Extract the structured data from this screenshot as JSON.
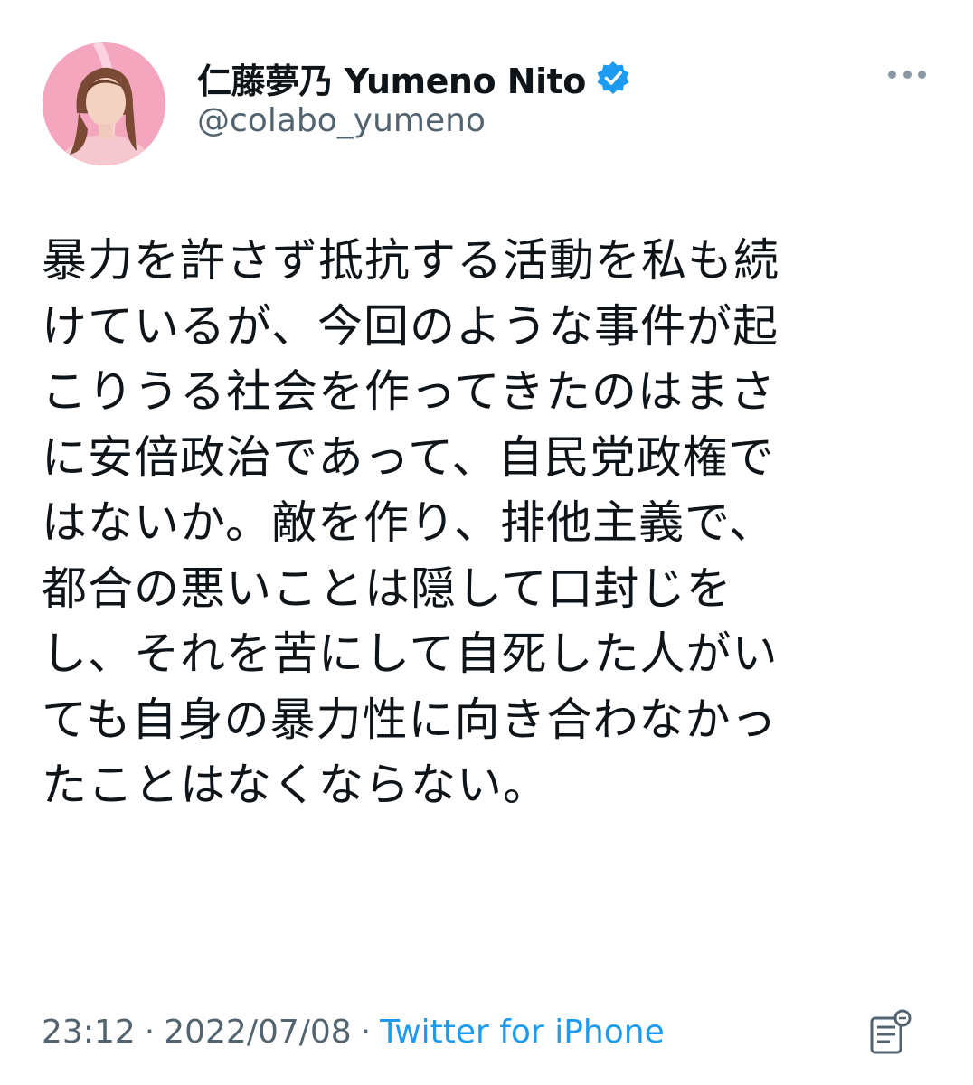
{
  "author": {
    "display_name": "仁藤夢乃 Yumeno Nito",
    "handle": "@colabo_yumeno",
    "verified": true,
    "avatar_icon": "profile-photo-avatar"
  },
  "tweet": {
    "lines": [
      "暴力を許さず抵抗する活動を私も続",
      "けているが、今回のような事件が起",
      "こりうる社会を作ってきたのはまさ",
      "に安倍政治であって、自民党政権で",
      "はないか。敵を作り、排他主義で、",
      "都合の悪いことは隠して口封じを",
      "し、それを苦にして自死した人がい",
      "ても自身の暴力性に向き合わなかっ",
      "たことはなくならない。"
    ]
  },
  "meta": {
    "time": "23:12",
    "separator": "·",
    "date": "2022/07/08",
    "source": "Twitter for iPhone"
  },
  "colors": {
    "text": "#0f1419",
    "secondary": "#536471",
    "accent": "#1d9bf0",
    "verified_badge": "#1d9bf0"
  },
  "icons": {
    "more": "more-dots-icon",
    "verified": "verified-badge-icon",
    "translate": "translate-icon"
  }
}
